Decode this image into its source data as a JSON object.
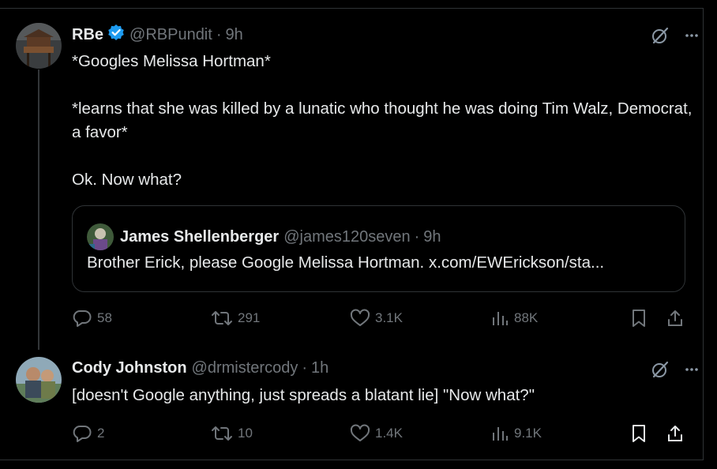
{
  "tweet1": {
    "display_name": "RBe",
    "handle": "@RBPundit",
    "separator": "·",
    "time": "9h",
    "paragraphs": [
      "*Googles Melissa Hortman*",
      "*learns that she was killed by a lunatic who thought he was doing Tim Walz, Democrat, a favor*",
      "Ok. Now what?"
    ],
    "quote": {
      "display_name": "James Shellenberger",
      "handle": "@james120seven",
      "separator": "·",
      "time": "9h",
      "text": "Brother Erick, please Google Melissa Hortman. x.com/EWErickson/sta..."
    },
    "actions": {
      "replies": "58",
      "reposts": "291",
      "likes": "3.1K",
      "views": "88K"
    }
  },
  "tweet2": {
    "display_name": "Cody Johnston",
    "handle": "@drmistercody",
    "separator": "·",
    "time": "1h",
    "text": "[doesn't Google anything, just spreads a blatant lie] \"Now what?\"",
    "actions": {
      "replies": "2",
      "reposts": "10",
      "likes": "1.4K",
      "views": "9.1K"
    }
  },
  "icons": {
    "verified": "verified-badge-icon",
    "grok": "grok-icon",
    "more": "more-icon",
    "reply": "reply-icon",
    "repost": "repost-icon",
    "like": "like-icon",
    "views": "views-icon",
    "bookmark": "bookmark-icon",
    "share": "share-icon"
  },
  "colors": {
    "background": "#000000",
    "text": "#e7e9ea",
    "muted": "#71767b",
    "border": "#2f3336",
    "verified": "#1d9bf0"
  }
}
